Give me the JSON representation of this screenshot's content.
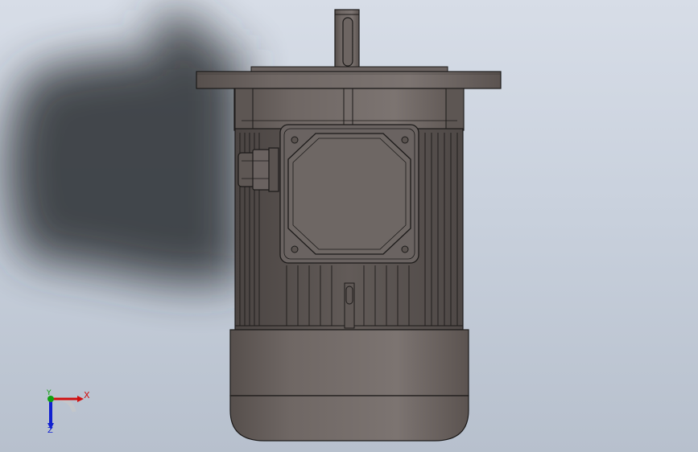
{
  "viewport": {
    "background_top": "#d7dde7",
    "background_bottom": "#b7c0cd",
    "model_color": "#6c6461",
    "edge_color": "#1c1a19"
  },
  "triad": {
    "x_label": "X",
    "y_label": "Y",
    "z_label": "Z",
    "x_color": "#d01010",
    "y_color": "#10a010",
    "z_color": "#1020d0"
  }
}
